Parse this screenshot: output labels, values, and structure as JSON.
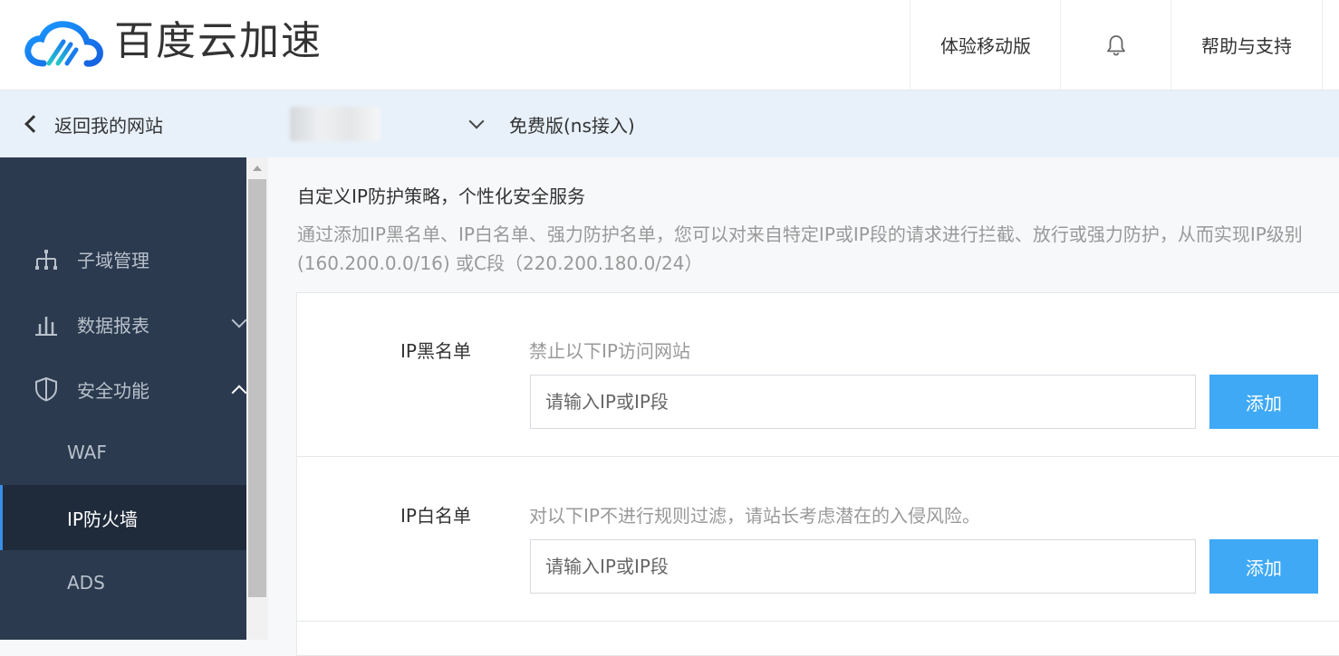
{
  "header": {
    "brand": "百度云加速",
    "nav": {
      "mobile": "体验移动版",
      "help": "帮助与支持"
    },
    "icons": {
      "logo": "baidu-cloud-logo",
      "bell": "bell-icon"
    }
  },
  "subbar": {
    "back_label": "返回我的网站",
    "plan": "免费版(ns接入)"
  },
  "sidebar": {
    "items": [
      {
        "label": "子域管理",
        "icon": "sitemap-icon"
      },
      {
        "label": "数据报表",
        "icon": "bar-chart-icon"
      },
      {
        "label": "安全功能",
        "icon": "shield-icon"
      }
    ],
    "sub_items": [
      {
        "label": "WAF"
      },
      {
        "label": "IP防火墙",
        "active": true
      },
      {
        "label": "ADS"
      }
    ]
  },
  "main": {
    "title": "自定义IP防护策略，个性化安全服务",
    "desc_line1": "通过添加IP黑名单、IP白名单、强力防护名单，您可以对来自特定IP或IP段的请求进行拦截、放行或强力防护，从而实现IP级别",
    "desc_line2": "(160.200.0.0/16) 或C段（220.200.180.0/24）",
    "blacklist": {
      "title": "IP黑名单",
      "hint": "禁止以下IP访问网站",
      "placeholder": "请输入IP或IP段",
      "button": "添加"
    },
    "whitelist": {
      "title": "IP白名单",
      "hint": "对以下IP不进行规则过滤，请站长考虑潜在的入侵风险。",
      "placeholder": "请输入IP或IP段",
      "button": "添加"
    }
  },
  "colors": {
    "accent": "#3fa9f5",
    "sidebar_bg": "#2b3a4e",
    "subbar_bg": "#e8f1fa"
  }
}
